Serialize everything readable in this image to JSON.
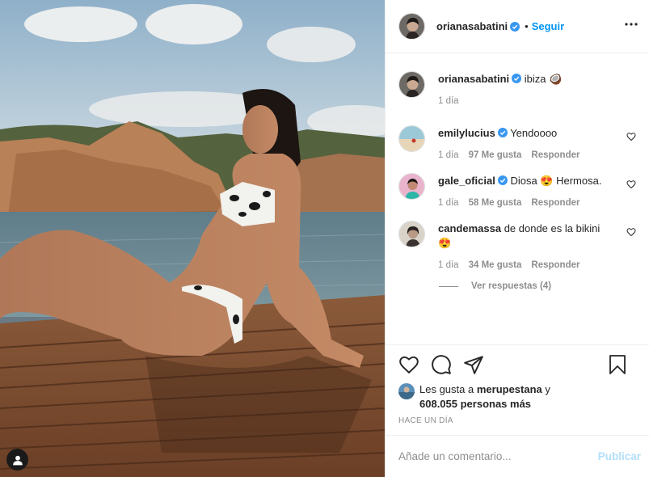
{
  "post": {
    "author": "orianasabatini",
    "follow_label": "Seguir",
    "dot": "•",
    "caption": "ibiza 🥥",
    "caption_time": "1 día",
    "comments": [
      {
        "user": "emilylucius",
        "verified": true,
        "text": "Yendoooo",
        "time": "1 día",
        "likes": "97 Me gusta",
        "reply": "Responder"
      },
      {
        "user": "gale_oficial",
        "verified": true,
        "text": "Diosa 😍 Hermosa.",
        "time": "1 día",
        "likes": "58 Me gusta",
        "reply": "Responder"
      },
      {
        "user": "candemassa",
        "verified": false,
        "text": "de donde es la bikini 😍",
        "time": "1 día",
        "likes": "34 Me gusta",
        "reply": "Responder"
      }
    ],
    "view_replies": "Ver respuestas (4)",
    "likes_prefix": "Les gusta a",
    "likes_user": "merupestana",
    "likes_join": "y",
    "likes_count": "608.055 personas más",
    "time_ago": "HACE UN DÍA",
    "comment_placeholder": "Añade un comentario...",
    "publish_label": "Publicar"
  },
  "colors": {
    "link": "#0095f6",
    "publish_disabled": "#b2dffc",
    "muted": "#8e8e8e",
    "verified": "#3897f0"
  },
  "icons": [
    "more-options-icon",
    "heart-icon",
    "comment-icon",
    "share-icon",
    "save-icon",
    "tag-user-icon",
    "verified-badge-icon"
  ]
}
